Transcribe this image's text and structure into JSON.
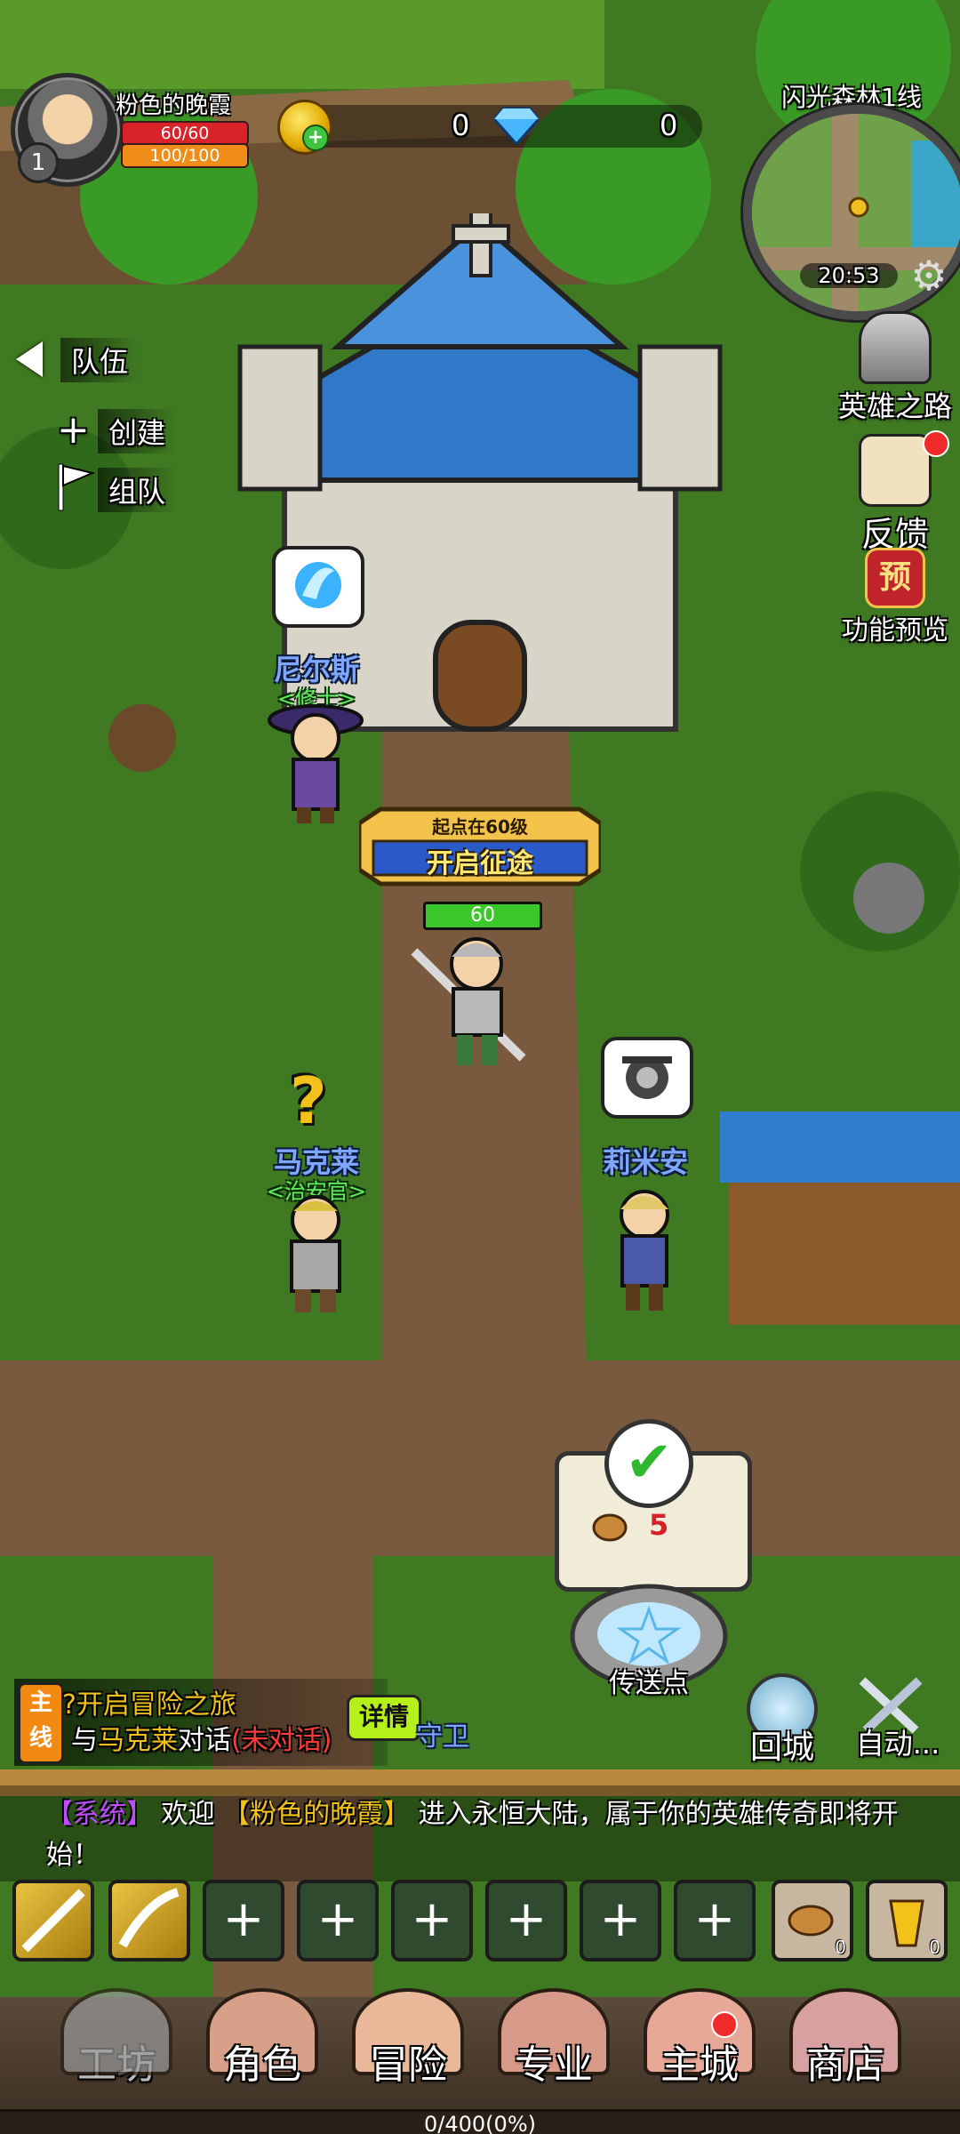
{
  "player": {
    "name": "粉色的晚霞",
    "level": "1",
    "hp_text": "60/60",
    "mp_text": "100/100"
  },
  "currency": {
    "gold": "0",
    "diamond": "0"
  },
  "minimap": {
    "title": "闪光森林1线",
    "time": "20:53"
  },
  "team": {
    "title": "队伍",
    "create": "创建",
    "group": "组队"
  },
  "side_buttons": {
    "hero_road": "英雄之路",
    "feedback": "反馈",
    "preview_badge": "预",
    "preview": "功能预览"
  },
  "npcs": {
    "nils": {
      "name": "尼尔斯",
      "title": "<修士>"
    },
    "mark": {
      "name": "马克莱",
      "title": "<治安官>"
    },
    "limian": {
      "name": "莉米安"
    }
  },
  "banner": {
    "line1": "起点在60级",
    "line2": "开启征途"
  },
  "player_hp_label": "60",
  "reward": {
    "count": "5"
  },
  "teleport": {
    "label": "传送点"
  },
  "quest": {
    "tag": "主线",
    "title": "开启冒险之旅",
    "desc_prefix": "与",
    "desc_npc": "马克莱",
    "desc_action": "对话",
    "desc_status": "(未对话)",
    "detail": "详情",
    "extra": "守卫"
  },
  "actions": {
    "return": "回城",
    "auto": "自动..."
  },
  "chat": {
    "system_tag": "【系统】",
    "welcome": "欢迎",
    "player": "【粉色的晚霞】",
    "message": "进入永恒大陆，属于你的英雄传奇即将开始！"
  },
  "items": {
    "bread_count": "0",
    "drink_count": "0"
  },
  "skill_slots": [
    "+",
    "+",
    "+",
    "+",
    "+",
    "+"
  ],
  "nav": {
    "workshop": "工坊",
    "role": "角色",
    "adventure": "冒险",
    "profession": "专业",
    "city": "主城",
    "shop": "商店"
  },
  "exp": "0/400(0%)",
  "colors": {
    "quest_orange": "#f28a12",
    "detail_green": "#b5f01a",
    "npc_blue": "#7fa6ff",
    "title_green": "#5df05a",
    "status_red": "#ff3a3a",
    "system_purple": "#c04cff"
  }
}
